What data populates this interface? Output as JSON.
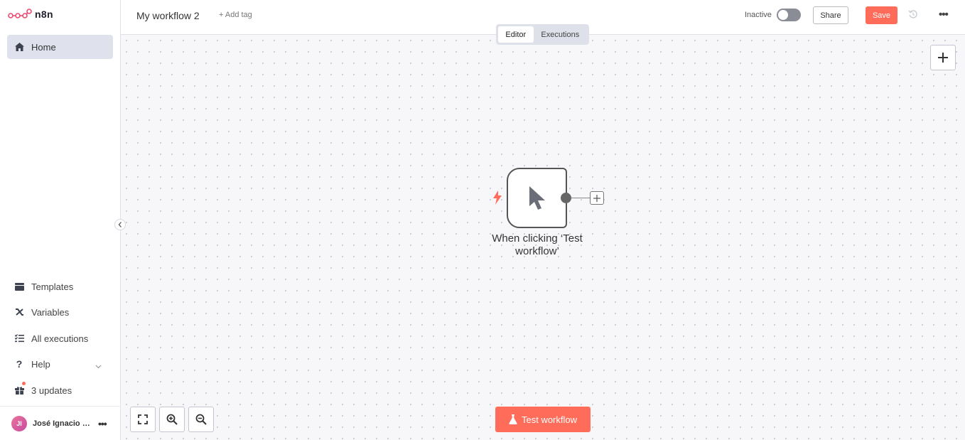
{
  "app": {
    "logo_text": "n8n"
  },
  "sidebar": {
    "home": "Home",
    "templates": "Templates",
    "variables": "Variables",
    "executions": "All executions",
    "help": "Help",
    "updates": "3 updates",
    "user": {
      "initials": "JI",
      "name": "José Ignacio Ga..."
    }
  },
  "header": {
    "workflow_name": "My workflow 2",
    "add_tag": "+ Add tag",
    "status_label": "Inactive",
    "share_label": "Share",
    "save_label": "Save"
  },
  "tabs": {
    "editor": "Editor",
    "executions": "Executions"
  },
  "node": {
    "label": "When clicking ‘Test workflow’"
  },
  "canvas": {
    "test_button": "Test workflow"
  },
  "colors": {
    "accent": "#ff6d5a",
    "sidebar_active": "#dfe2ec"
  }
}
